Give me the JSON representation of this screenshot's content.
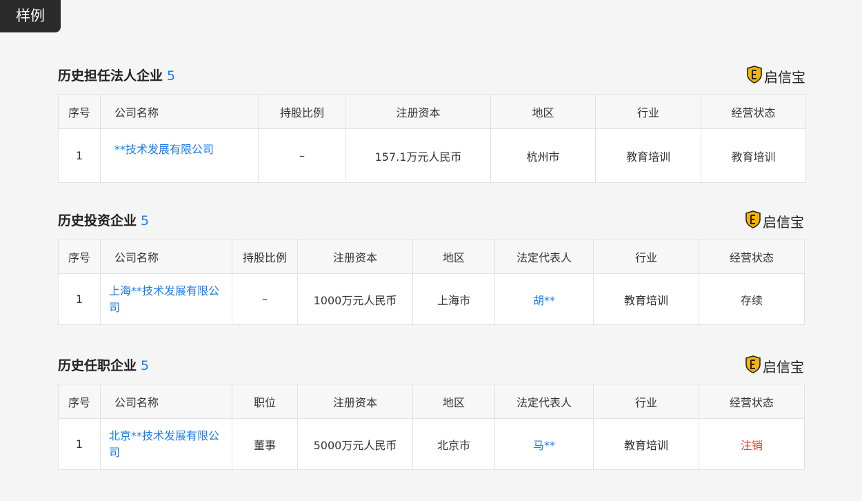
{
  "tag": "样例",
  "brand": {
    "name": "启信宝",
    "logo_icon": "qixinbao-shield-icon"
  },
  "colors": {
    "link": "#1a7cf0",
    "cancelled": "#e8432a",
    "tag_bg": "#2b2b2b"
  },
  "sections": [
    {
      "title": "历史担任法人企业",
      "count": "5",
      "headers": [
        "序号",
        "公司名称",
        "持股比例",
        "注册资本",
        "地区",
        "行业",
        "经营状态"
      ],
      "rows": [
        {
          "no": "1",
          "company": "**技术发展有限公司",
          "ratio": "–",
          "capital": "157.1万元人民币",
          "region": "杭州市",
          "industry": "教育培训",
          "status": "教育培训"
        }
      ]
    },
    {
      "title": "历史投资企业",
      "count": "5",
      "headers": [
        "序号",
        "公司名称",
        "持股比例",
        "注册资本",
        "地区",
        "法定代表人",
        "行业",
        "经营状态"
      ],
      "rows": [
        {
          "no": "1",
          "company": "上海**技术发展有限公司",
          "ratio": "–",
          "capital": "1000万元人民币",
          "region": "上海市",
          "legal_rep": "胡**",
          "industry": "教育培训",
          "status": "存续"
        }
      ]
    },
    {
      "title": "历史任职企业",
      "count": "5",
      "headers": [
        "序号",
        "公司名称",
        "职位",
        "注册资本",
        "地区",
        "法定代表人",
        "行业",
        "经营状态"
      ],
      "rows": [
        {
          "no": "1",
          "company": "北京**技术发展有限公司",
          "position": "董事",
          "capital": "5000万元人民币",
          "region": "北京市",
          "legal_rep": "马**",
          "industry": "教育培训",
          "status": "注销"
        }
      ]
    }
  ]
}
